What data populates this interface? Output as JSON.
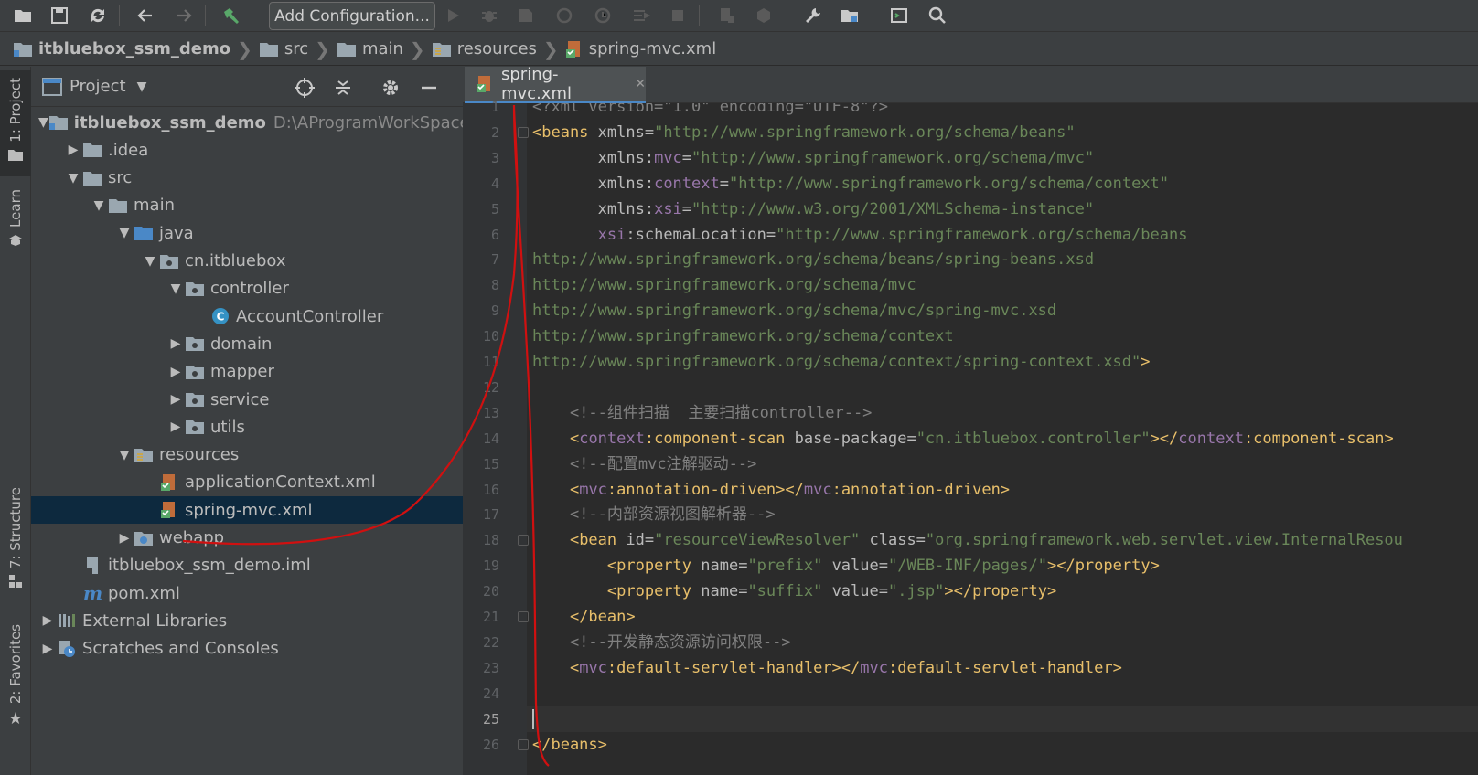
{
  "toolbar": {
    "run_config_label": "Add Configuration...",
    "icons": [
      "open-folder-icon",
      "save-icon",
      "sync-icon",
      "back-icon",
      "forward-icon",
      "build-hammer-icon",
      "run-icon",
      "debug-icon",
      "coverage-icon",
      "profile-icon",
      "attach-icon",
      "step-icon",
      "stop-icon",
      "device-icon",
      "deploy-icon",
      "wrench-icon",
      "project-structure-icon",
      "terminal-icon",
      "search-icon"
    ]
  },
  "breadcrumb": {
    "items": [
      "itbluebox_ssm_demo",
      "src",
      "main",
      "resources",
      "spring-mvc.xml"
    ]
  },
  "left_strip": {
    "project_tab": "1: Project",
    "learn_tab": "Learn",
    "structure_tab": "7: Structure",
    "favorites_tab": "2: Favorites"
  },
  "project_panel": {
    "title": "Project",
    "tree": [
      {
        "label": "itbluebox_ssm_demo",
        "path": "D:\\AProgramWorkSpace\\ide",
        "icon": "module-icon",
        "depth": 0,
        "expanded": true,
        "bold": true
      },
      {
        "label": ".idea",
        "icon": "folder-icon",
        "depth": 1,
        "expanded": false
      },
      {
        "label": "src",
        "icon": "folder-icon",
        "depth": 1,
        "expanded": true
      },
      {
        "label": "main",
        "icon": "folder-icon",
        "depth": 2,
        "expanded": true
      },
      {
        "label": "java",
        "icon": "source-folder-icon",
        "depth": 3,
        "expanded": true
      },
      {
        "label": "cn.itbluebox",
        "icon": "package-icon",
        "depth": 4,
        "expanded": true
      },
      {
        "label": "controller",
        "icon": "package-icon",
        "depth": 5,
        "expanded": true
      },
      {
        "label": "AccountController",
        "icon": "class-icon",
        "depth": 6,
        "leaf": true
      },
      {
        "label": "domain",
        "icon": "package-icon",
        "depth": 5,
        "expanded": false
      },
      {
        "label": "mapper",
        "icon": "package-icon",
        "depth": 5,
        "expanded": false
      },
      {
        "label": "service",
        "icon": "package-icon",
        "depth": 5,
        "expanded": false
      },
      {
        "label": "utils",
        "icon": "package-icon",
        "depth": 5,
        "expanded": false
      },
      {
        "label": "resources",
        "icon": "resources-folder-icon",
        "depth": 3,
        "expanded": true
      },
      {
        "label": "applicationContext.xml",
        "icon": "spring-xml-icon",
        "depth": 4,
        "leaf": true
      },
      {
        "label": "spring-mvc.xml",
        "icon": "spring-xml-icon",
        "depth": 4,
        "leaf": true,
        "selected": true
      },
      {
        "label": "webapp",
        "icon": "web-folder-icon",
        "depth": 3,
        "expanded": false
      },
      {
        "label": "itbluebox_ssm_demo.iml",
        "icon": "iml-file-icon",
        "depth": 1,
        "leaf": true
      },
      {
        "label": "pom.xml",
        "icon": "maven-icon",
        "depth": 1,
        "leaf": true
      },
      {
        "label": "External Libraries",
        "icon": "libraries-icon",
        "depth": 0,
        "expanded": false
      },
      {
        "label": "Scratches and Consoles",
        "icon": "scratches-icon",
        "depth": 0,
        "expanded": false
      }
    ]
  },
  "editor": {
    "tab_label": "spring-mvc.xml",
    "current_line": 25,
    "lines": [
      [
        [
          "t-cmt",
          "<?xml version=\"1.0\" encoding=\"UTF-8\"?>"
        ]
      ],
      [
        [
          "t-tag",
          "<beans "
        ],
        [
          "t-attr",
          "xmlns="
        ],
        [
          "t-val",
          "\"http://www.springframework.org/schema/beans\""
        ]
      ],
      [
        [
          "",
          "       "
        ],
        [
          "t-attr",
          "xmlns:"
        ],
        [
          "t-ns",
          "mvc"
        ],
        [
          "t-attr",
          "="
        ],
        [
          "t-val",
          "\"http://www.springframework.org/schema/mvc\""
        ]
      ],
      [
        [
          "",
          "       "
        ],
        [
          "t-attr",
          "xmlns:"
        ],
        [
          "t-ns",
          "context"
        ],
        [
          "t-attr",
          "="
        ],
        [
          "t-val",
          "\"http://www.springframework.org/schema/context\""
        ]
      ],
      [
        [
          "",
          "       "
        ],
        [
          "t-attr",
          "xmlns:"
        ],
        [
          "t-ns",
          "xsi"
        ],
        [
          "t-attr",
          "="
        ],
        [
          "t-val",
          "\"http://www.w3.org/2001/XMLSchema-instance\""
        ]
      ],
      [
        [
          "",
          "       "
        ],
        [
          "t-ns",
          "xsi"
        ],
        [
          "t-attr",
          ":schemaLocation="
        ],
        [
          "t-val",
          "\"http://www.springframework.org/schema/beans"
        ]
      ],
      [
        [
          "t-val",
          "http://www.springframework.org/schema/beans/spring-beans.xsd"
        ]
      ],
      [
        [
          "t-val",
          "http://www.springframework.org/schema/mvc"
        ]
      ],
      [
        [
          "t-val",
          "http://www.springframework.org/schema/mvc/spring-mvc.xsd"
        ]
      ],
      [
        [
          "t-val",
          "http://www.springframework.org/schema/context"
        ]
      ],
      [
        [
          "t-val",
          "http://www.springframework.org/schema/context/spring-context.xsd\""
        ],
        [
          "t-tag",
          ">"
        ]
      ],
      [],
      [
        [
          "",
          "    "
        ],
        [
          "t-cmt",
          "<!--组件扫描  主要扫描controller-->"
        ]
      ],
      [
        [
          "",
          "    "
        ],
        [
          "t-tag",
          "<"
        ],
        [
          "t-ns",
          "context"
        ],
        [
          "t-tag",
          ":component-scan "
        ],
        [
          "t-attr",
          "base-package="
        ],
        [
          "t-val",
          "\"cn.itbluebox.controller\""
        ],
        [
          "t-tag",
          "></"
        ],
        [
          "t-ns",
          "context"
        ],
        [
          "t-tag",
          ":component-scan>"
        ]
      ],
      [
        [
          "",
          "    "
        ],
        [
          "t-cmt",
          "<!--配置mvc注解驱动-->"
        ]
      ],
      [
        [
          "",
          "    "
        ],
        [
          "t-tag",
          "<"
        ],
        [
          "t-ns",
          "mvc"
        ],
        [
          "t-tag",
          ":annotation-driven></"
        ],
        [
          "t-ns",
          "mvc"
        ],
        [
          "t-tag",
          ":annotation-driven>"
        ]
      ],
      [
        [
          "",
          "    "
        ],
        [
          "t-cmt",
          "<!--内部资源视图解析器-->"
        ]
      ],
      [
        [
          "",
          "    "
        ],
        [
          "t-tag",
          "<bean "
        ],
        [
          "t-attr",
          "id="
        ],
        [
          "t-val",
          "\"resourceViewResolver\""
        ],
        [
          "t-attr",
          " class="
        ],
        [
          "t-val",
          "\"org.springframework.web.servlet.view.InternalResou"
        ]
      ],
      [
        [
          "",
          "        "
        ],
        [
          "t-tag",
          "<property "
        ],
        [
          "t-attr",
          "name="
        ],
        [
          "t-val",
          "\"prefix\""
        ],
        [
          "t-attr",
          " value="
        ],
        [
          "t-val",
          "\"/WEB-INF/pages/\""
        ],
        [
          "t-tag",
          "></property>"
        ]
      ],
      [
        [
          "",
          "        "
        ],
        [
          "t-tag",
          "<property "
        ],
        [
          "t-attr",
          "name="
        ],
        [
          "t-val",
          "\"suffix\""
        ],
        [
          "t-attr",
          " value="
        ],
        [
          "t-val",
          "\".jsp\""
        ],
        [
          "t-tag",
          "></property>"
        ]
      ],
      [
        [
          "",
          "    "
        ],
        [
          "t-tag",
          "</bean>"
        ]
      ],
      [
        [
          "",
          "    "
        ],
        [
          "t-cmt",
          "<!--开发静态资源访问权限-->"
        ]
      ],
      [
        [
          "",
          "    "
        ],
        [
          "t-tag",
          "<"
        ],
        [
          "t-ns",
          "mvc"
        ],
        [
          "t-tag",
          ":default-servlet-handler></"
        ],
        [
          "t-ns",
          "mvc"
        ],
        [
          "t-tag",
          ":default-servlet-handler>"
        ]
      ],
      [],
      [],
      [
        [
          "t-tag",
          "</beans>"
        ]
      ]
    ]
  },
  "colors": {
    "annotation_line": "#d01010",
    "selection": "#0d293e",
    "tab_accent": "#4a88c7"
  }
}
